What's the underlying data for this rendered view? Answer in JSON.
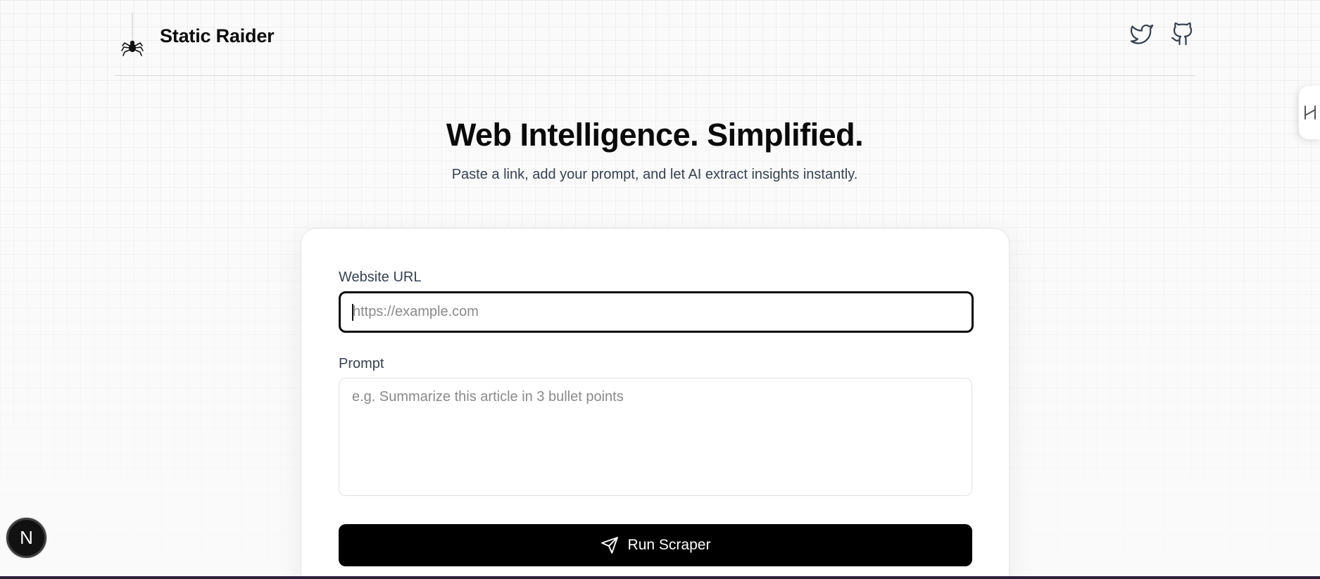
{
  "header": {
    "brand_name": "Static Raider",
    "logo_icon": "spider-icon",
    "social": [
      {
        "icon": "twitter-icon"
      },
      {
        "icon": "github-icon"
      }
    ]
  },
  "hero": {
    "title": "Web Intelligence. Simplified.",
    "subtitle": "Paste a link, add your prompt, and let AI extract insights instantly."
  },
  "form": {
    "url": {
      "label": "Website URL",
      "placeholder": "https://example.com",
      "value": ""
    },
    "prompt": {
      "label": "Prompt",
      "placeholder": "e.g. Summarize this article in 3 bullet points",
      "value": ""
    },
    "submit": {
      "label": "Run Scraper",
      "icon": "send-icon"
    }
  },
  "overlays": {
    "nextjs_badge": "N",
    "side_tab_icon": "slider-handle-icon"
  },
  "colors": {
    "background": "#fafafa",
    "primary_button": "#000000",
    "text_primary": "#0a0a0a",
    "text_secondary": "#374151"
  }
}
